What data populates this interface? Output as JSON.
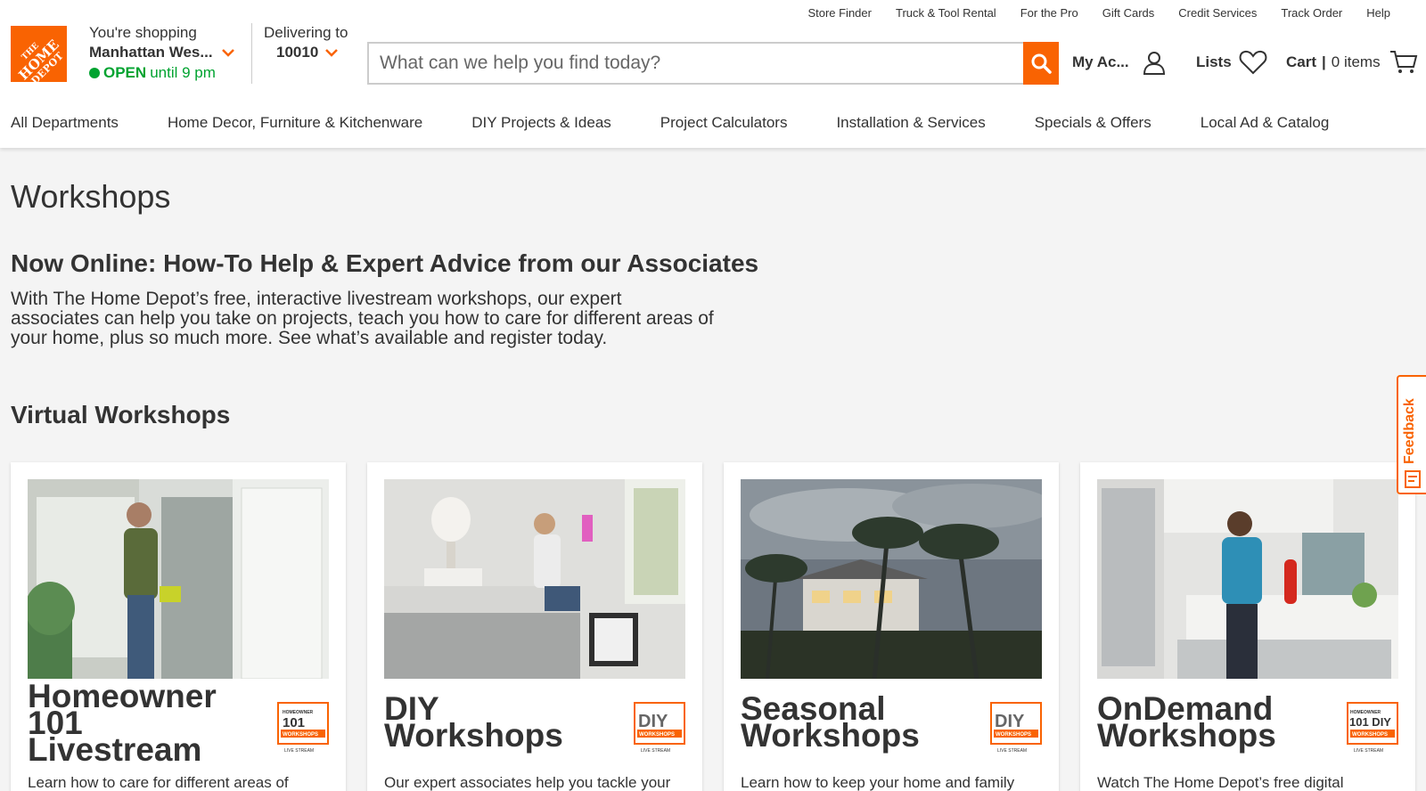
{
  "utility_links": [
    "Store Finder",
    "Truck & Tool Rental",
    "For the Pro",
    "Gift Cards",
    "Credit Services",
    "Track Order",
    "Help"
  ],
  "logo": {
    "line1": "THE",
    "line2": "HOME",
    "line3": "DEPOT"
  },
  "store": {
    "label": "You're shopping",
    "name": "Manhattan Wes...",
    "open": "OPEN",
    "hours": "until 9 pm"
  },
  "delivery": {
    "label": "Delivering to",
    "zip": "10010"
  },
  "search": {
    "placeholder": "What can we help you find today?"
  },
  "account": {
    "label": "My Ac..."
  },
  "lists": {
    "label": "Lists"
  },
  "cart": {
    "label": "Cart",
    "separator": "|",
    "items": "0 items"
  },
  "nav": [
    "All Departments",
    "Home Decor, Furniture & Kitchenware",
    "DIY Projects & Ideas",
    "Project Calculators",
    "Installation & Services",
    "Specials & Offers",
    "Local Ad & Catalog"
  ],
  "page": {
    "title": "Workshops",
    "heading": "Now Online: How-To Help & Expert Advice from our Associates",
    "intro": "With The Home Depot’s free, interactive livestream workshops, our expert associates can help you take on projects, teach you how to care for different areas of your home, plus so much more. See what’s available and register today.",
    "section": "Virtual Workshops"
  },
  "cards": [
    {
      "title": "Homeowner 101 Livestream",
      "desc": "Learn how to care for different areas of",
      "badge_top": "HOMEOWNER",
      "badge_main": "101",
      "badge_sub": "WORKSHOPS",
      "badge_foot": "LIVE STREAM"
    },
    {
      "title": "DIY Workshops",
      "desc": "Our expert associates help you tackle your",
      "badge_top": "",
      "badge_main": "DIY",
      "badge_sub": "WORKSHOPS",
      "badge_foot": "LIVE STREAM"
    },
    {
      "title": "Seasonal Workshops",
      "desc": "Learn how to keep your home and family",
      "badge_top": "",
      "badge_main": "DIY",
      "badge_sub": "WORKSHOPS",
      "badge_foot": "LIVE STREAM"
    },
    {
      "title": "OnDemand Workshops",
      "desc": "Watch The Home Depot’s free digital",
      "badge_top": "HOMEOWNER",
      "badge_main": "101 DIY",
      "badge_sub": "WORKSHOPS",
      "badge_foot": "LIVE STREAM"
    }
  ],
  "feedback": {
    "label": "Feedback"
  },
  "colors": {
    "brand": "#f96302",
    "open": "#00a330"
  }
}
